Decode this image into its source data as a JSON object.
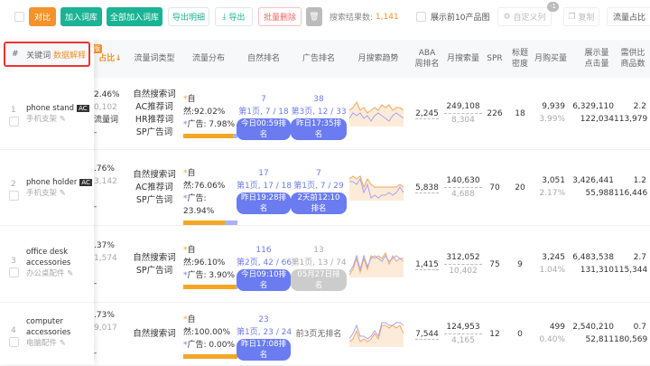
{
  "toolbar": {
    "compare": "对比",
    "add_lib": "加入词库",
    "add_all": "全部加入词库",
    "export_detail": "导出明细",
    "export": "导出",
    "batch_delete": "批量删除",
    "search_results_label": "搜索结果数:",
    "search_results_value": "1,141",
    "show_top10": "展示前10产品图",
    "custom_cols": "自定义列",
    "custom_badge": "-1",
    "copy": "复制",
    "traffic_share": "流量占比"
  },
  "header": {
    "index": "#",
    "keyword": "关键词",
    "data_explain": "数据解释",
    "share": "占比↓",
    "share_badge": "版",
    "type": "流量词类型",
    "dist": "流量分布",
    "natural": "自然排名",
    "ad": "广告排名",
    "trend": "月搜索趋势",
    "aba": "ABA\n周排名",
    "monthly_search": "月搜索量",
    "spr": "SPR",
    "title_density": "标题\n密度",
    "monthly_buy": "月购买量",
    "impressions": "展示量\n点击量",
    "supply": "需供比\n商品数"
  },
  "rows": [
    {
      "idx": "1",
      "kw": "phone stand",
      "ac": "AC",
      "cn": "手机支架",
      "share": "2.46%",
      "share2": "0,102",
      "share3": "流量词",
      "share4": "-",
      "types": [
        "自然搜索词",
        "AC推荐词",
        "HR推荐词",
        "SP广告词"
      ],
      "nat_pct": "92.02%",
      "ad_pct": "7.98%",
      "nat_frac": 0.92,
      "nat_rank": "7",
      "nat_page": "第1页, 7 / 18",
      "nat_time": "今日00:59排名",
      "nat_grey": false,
      "ad_rank": "38",
      "ad_page": "第3页, 12 / 33",
      "ad_time": "昨日17:35排名",
      "ad_grey": false,
      "aba": "2,245",
      "ms": "249,108",
      "ms2": "8,304",
      "spr": "226",
      "td": "18",
      "mb": "9,939",
      "mb2": "3.99%",
      "imp": "6,329,110",
      "clk": "122,034",
      "ratio": "2.2",
      "goods": "113,979",
      "trend_a": [
        6,
        7,
        9,
        6,
        7,
        5,
        6,
        7,
        6,
        8,
        7,
        8,
        6,
        7,
        7,
        6
      ],
      "trend_b": [
        3,
        5,
        4,
        5,
        3,
        4,
        2,
        4,
        5,
        4,
        3,
        2,
        4,
        5,
        4,
        3
      ]
    },
    {
      "idx": "2",
      "kw": "phone holder",
      "ac": "AC",
      "cn": "手机支架",
      "share": ".76%",
      "share2": "3,142",
      "share3": "",
      "share4": "-",
      "types": [
        "自然搜索词",
        "AC推荐词",
        "SP广告词"
      ],
      "nat_pct": "76.06%",
      "ad_pct": "23.94%",
      "nat_frac": 0.76,
      "nat_rank": "17",
      "nat_page": "第1页, 17 / 18",
      "nat_time": "昨日19:28排名",
      "nat_grey": false,
      "ad_rank": "7",
      "ad_page": "第1页, 7 / 29",
      "ad_time": "2天前12:10排名",
      "ad_grey": false,
      "aba": "5,838",
      "ms": "140,630",
      "ms2": "4,688",
      "spr": "70",
      "td": "20",
      "mb": "3,051",
      "mb2": "2.17%",
      "imp": "3,426,441",
      "clk": "55,988",
      "ratio": "1.2",
      "goods": "116,446",
      "trend_a": [
        8,
        9,
        8,
        9,
        5,
        8,
        6,
        5,
        5,
        5,
        5,
        5,
        5,
        5,
        6,
        5
      ],
      "trend_b": [
        7,
        7,
        6,
        8,
        3,
        6,
        1,
        2,
        1,
        2,
        2,
        3,
        2,
        3,
        5,
        3
      ]
    },
    {
      "idx": "3",
      "kw": "office desk accessories",
      "ac": "",
      "cn": "办公桌配件",
      "share": ".37%",
      "share2": "1,574",
      "share3": "",
      "share4": "-",
      "types": [
        "自然搜索词",
        "SP广告词"
      ],
      "nat_pct": "96.10%",
      "ad_pct": "3.90%",
      "nat_frac": 0.96,
      "nat_rank": "116",
      "nat_page": "第2页, 42 / 66",
      "nat_time": "今日09:10排名",
      "nat_grey": false,
      "ad_rank": "13",
      "ad_page": "第1页, 13 / 74",
      "ad_time": "05月27日排名",
      "ad_grey": true,
      "aba": "1,415",
      "ms": "312,052",
      "ms2": "10,402",
      "spr": "75",
      "td": "9",
      "mb": "3,245",
      "mb2": "1.04%",
      "imp": "6,483,538",
      "clk": "131,310",
      "ratio": "2.7",
      "goods": "115,344",
      "trend_a": [
        1,
        3,
        7,
        2,
        7,
        3,
        8,
        7,
        8,
        7,
        9,
        5,
        8,
        6,
        7,
        6
      ],
      "trend_b": [
        2,
        4,
        8,
        3,
        8,
        4,
        7,
        8,
        7,
        6,
        8,
        6,
        7,
        8,
        7,
        7
      ]
    },
    {
      "idx": "4",
      "kw": "computer accessories",
      "ac": "",
      "cn": "电脑配件",
      "share": ".73%",
      "share2": "9,017",
      "share3": "",
      "share4": "-",
      "types": [
        "自然搜索词"
      ],
      "nat_pct": "100.00%",
      "ad_pct": "0.00%",
      "nat_frac": 1.0,
      "nat_rank": "23",
      "nat_page": "第1页, 23 / 24",
      "nat_time": "昨日17:08排名",
      "nat_grey": false,
      "ad_rank": "",
      "ad_page": "前3页无排名",
      "ad_time": "",
      "ad_grey": false,
      "aba": "7,544",
      "ms": "124,953",
      "ms2": "4,165",
      "spr": "12",
      "td": "0",
      "mb": "499",
      "mb2": "0.40%",
      "imp": "2,540,210",
      "clk": "52,811",
      "ratio": "0.7",
      "goods": "180,569",
      "trend_a": [
        2,
        3,
        6,
        2,
        3,
        2,
        3,
        5,
        3,
        8,
        8,
        7,
        8,
        7,
        8,
        5
      ],
      "trend_b": [
        3,
        5,
        8,
        4,
        4,
        3,
        4,
        6,
        4,
        9,
        9,
        8,
        8,
        9,
        9,
        8
      ]
    }
  ]
}
